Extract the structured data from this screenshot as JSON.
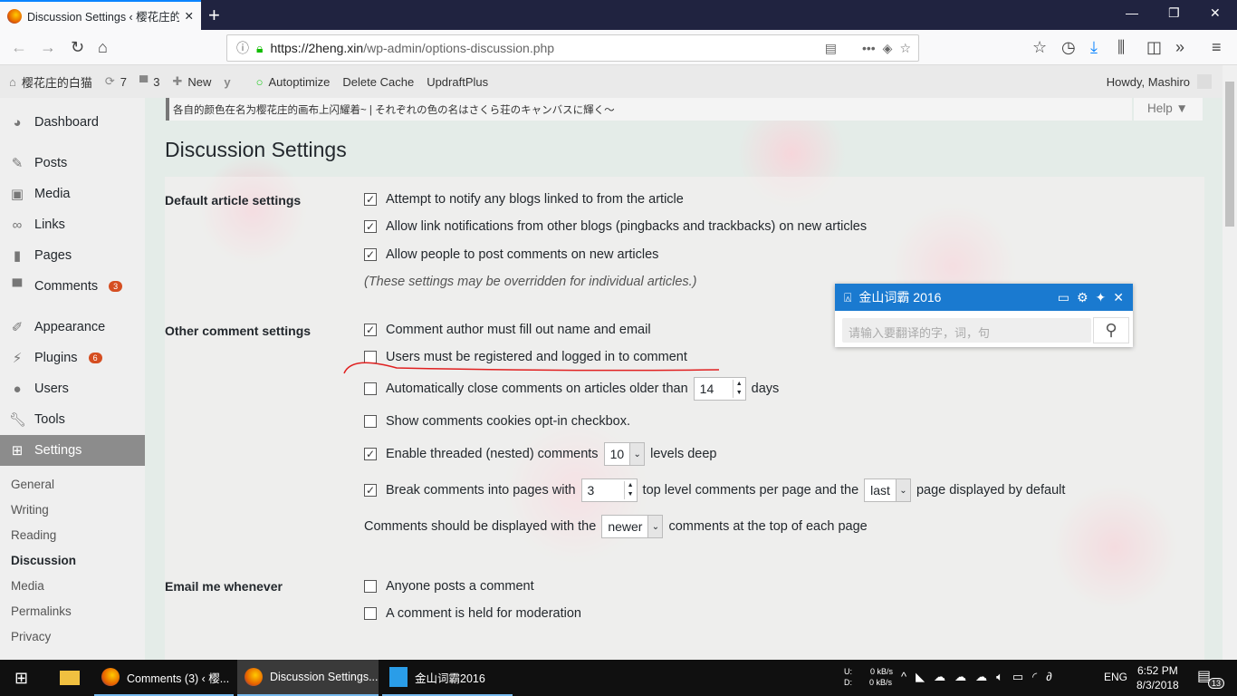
{
  "browser": {
    "tab_title": "Discussion Settings ‹ 樱花庄的白",
    "new_tab": "+",
    "url_host": "https://2heng.xin",
    "url_path": "/wp-admin/options-discussion.php"
  },
  "adminbar": {
    "site": "樱花庄的白猫",
    "updates": "7",
    "comments": "3",
    "new": "New",
    "autoptimize": "Autoptimize",
    "delete_cache": "Delete Cache",
    "updraft": "UpdraftPlus",
    "howdy": "Howdy, Mashiro"
  },
  "sidebar": {
    "items": [
      {
        "label": "Dashboard"
      },
      {
        "label": "Posts"
      },
      {
        "label": "Media"
      },
      {
        "label": "Links"
      },
      {
        "label": "Pages"
      },
      {
        "label": "Comments",
        "badge": "3"
      },
      {
        "label": "Appearance"
      },
      {
        "label": "Plugins",
        "badge": "6"
      },
      {
        "label": "Users"
      },
      {
        "label": "Tools"
      },
      {
        "label": "Settings"
      }
    ],
    "submenu": [
      "General",
      "Writing",
      "Reading",
      "Discussion",
      "Media",
      "Permalinks",
      "Privacy"
    ]
  },
  "notice": "各自的颜色在名为樱花庄的画布上闪耀着~ | それぞれの色の名はさくら荘のキャンバスに輝く～",
  "help": "Help ▼",
  "title": "Discussion Settings",
  "sections": {
    "default_label": "Default article settings",
    "d1": "Attempt to notify any blogs linked to from the article",
    "d2": "Allow link notifications from other blogs (pingbacks and trackbacks) on new articles",
    "d3": "Allow people to post comments on new articles",
    "d_note": "(These settings may be overridden for individual articles.)",
    "other_label": "Other comment settings",
    "o1": "Comment author must fill out name and email",
    "o2": "Users must be registered and logged in to comment",
    "o3a": "Automatically close comments on articles older than",
    "o3v": "14",
    "o3b": "days",
    "o4": "Show comments cookies opt-in checkbox.",
    "o5a": "Enable threaded (nested) comments",
    "o5v": "10",
    "o5b": "levels deep",
    "o6a": "Break comments into pages with",
    "o6v": "3",
    "o6b": "top level comments per page and the",
    "o6s": "last",
    "o6c": "page displayed by default",
    "o7a": "Comments should be displayed with the",
    "o7s": "newer",
    "o7b": "comments at the top of each page",
    "email_label": "Email me whenever",
    "e1": "Anyone posts a comment",
    "e2": "A comment is held for moderation"
  },
  "popup": {
    "title": "金山词霸 2016",
    "placeholder": "请输入要翻译的字，词，句"
  },
  "taskbar": {
    "t1": "Comments (3) ‹ 樱...",
    "t2": "Discussion Settings...",
    "t3": "金山词霸2016",
    "up": "U:",
    "down": "D:",
    "up_v": "0 kB/s",
    "down_v": "0 kB/s",
    "lang": "ENG",
    "time": "6:52 PM",
    "date": "8/3/2018",
    "notif": "13"
  }
}
